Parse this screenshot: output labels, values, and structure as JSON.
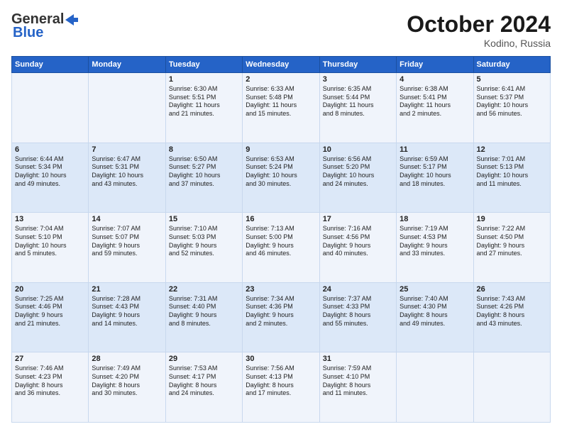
{
  "header": {
    "logo_general": "General",
    "logo_blue": "Blue",
    "month_title": "October 2024",
    "location": "Kodino, Russia"
  },
  "weekdays": [
    "Sunday",
    "Monday",
    "Tuesday",
    "Wednesday",
    "Thursday",
    "Friday",
    "Saturday"
  ],
  "weeks": [
    [
      {
        "day": "",
        "lines": []
      },
      {
        "day": "",
        "lines": []
      },
      {
        "day": "1",
        "lines": [
          "Sunrise: 6:30 AM",
          "Sunset: 5:51 PM",
          "Daylight: 11 hours",
          "and 21 minutes."
        ]
      },
      {
        "day": "2",
        "lines": [
          "Sunrise: 6:33 AM",
          "Sunset: 5:48 PM",
          "Daylight: 11 hours",
          "and 15 minutes."
        ]
      },
      {
        "day": "3",
        "lines": [
          "Sunrise: 6:35 AM",
          "Sunset: 5:44 PM",
          "Daylight: 11 hours",
          "and 8 minutes."
        ]
      },
      {
        "day": "4",
        "lines": [
          "Sunrise: 6:38 AM",
          "Sunset: 5:41 PM",
          "Daylight: 11 hours",
          "and 2 minutes."
        ]
      },
      {
        "day": "5",
        "lines": [
          "Sunrise: 6:41 AM",
          "Sunset: 5:37 PM",
          "Daylight: 10 hours",
          "and 56 minutes."
        ]
      }
    ],
    [
      {
        "day": "6",
        "lines": [
          "Sunrise: 6:44 AM",
          "Sunset: 5:34 PM",
          "Daylight: 10 hours",
          "and 49 minutes."
        ]
      },
      {
        "day": "7",
        "lines": [
          "Sunrise: 6:47 AM",
          "Sunset: 5:31 PM",
          "Daylight: 10 hours",
          "and 43 minutes."
        ]
      },
      {
        "day": "8",
        "lines": [
          "Sunrise: 6:50 AM",
          "Sunset: 5:27 PM",
          "Daylight: 10 hours",
          "and 37 minutes."
        ]
      },
      {
        "day": "9",
        "lines": [
          "Sunrise: 6:53 AM",
          "Sunset: 5:24 PM",
          "Daylight: 10 hours",
          "and 30 minutes."
        ]
      },
      {
        "day": "10",
        "lines": [
          "Sunrise: 6:56 AM",
          "Sunset: 5:20 PM",
          "Daylight: 10 hours",
          "and 24 minutes."
        ]
      },
      {
        "day": "11",
        "lines": [
          "Sunrise: 6:59 AM",
          "Sunset: 5:17 PM",
          "Daylight: 10 hours",
          "and 18 minutes."
        ]
      },
      {
        "day": "12",
        "lines": [
          "Sunrise: 7:01 AM",
          "Sunset: 5:13 PM",
          "Daylight: 10 hours",
          "and 11 minutes."
        ]
      }
    ],
    [
      {
        "day": "13",
        "lines": [
          "Sunrise: 7:04 AM",
          "Sunset: 5:10 PM",
          "Daylight: 10 hours",
          "and 5 minutes."
        ]
      },
      {
        "day": "14",
        "lines": [
          "Sunrise: 7:07 AM",
          "Sunset: 5:07 PM",
          "Daylight: 9 hours",
          "and 59 minutes."
        ]
      },
      {
        "day": "15",
        "lines": [
          "Sunrise: 7:10 AM",
          "Sunset: 5:03 PM",
          "Daylight: 9 hours",
          "and 52 minutes."
        ]
      },
      {
        "day": "16",
        "lines": [
          "Sunrise: 7:13 AM",
          "Sunset: 5:00 PM",
          "Daylight: 9 hours",
          "and 46 minutes."
        ]
      },
      {
        "day": "17",
        "lines": [
          "Sunrise: 7:16 AM",
          "Sunset: 4:56 PM",
          "Daylight: 9 hours",
          "and 40 minutes."
        ]
      },
      {
        "day": "18",
        "lines": [
          "Sunrise: 7:19 AM",
          "Sunset: 4:53 PM",
          "Daylight: 9 hours",
          "and 33 minutes."
        ]
      },
      {
        "day": "19",
        "lines": [
          "Sunrise: 7:22 AM",
          "Sunset: 4:50 PM",
          "Daylight: 9 hours",
          "and 27 minutes."
        ]
      }
    ],
    [
      {
        "day": "20",
        "lines": [
          "Sunrise: 7:25 AM",
          "Sunset: 4:46 PM",
          "Daylight: 9 hours",
          "and 21 minutes."
        ]
      },
      {
        "day": "21",
        "lines": [
          "Sunrise: 7:28 AM",
          "Sunset: 4:43 PM",
          "Daylight: 9 hours",
          "and 14 minutes."
        ]
      },
      {
        "day": "22",
        "lines": [
          "Sunrise: 7:31 AM",
          "Sunset: 4:40 PM",
          "Daylight: 9 hours",
          "and 8 minutes."
        ]
      },
      {
        "day": "23",
        "lines": [
          "Sunrise: 7:34 AM",
          "Sunset: 4:36 PM",
          "Daylight: 9 hours",
          "and 2 minutes."
        ]
      },
      {
        "day": "24",
        "lines": [
          "Sunrise: 7:37 AM",
          "Sunset: 4:33 PM",
          "Daylight: 8 hours",
          "and 55 minutes."
        ]
      },
      {
        "day": "25",
        "lines": [
          "Sunrise: 7:40 AM",
          "Sunset: 4:30 PM",
          "Daylight: 8 hours",
          "and 49 minutes."
        ]
      },
      {
        "day": "26",
        "lines": [
          "Sunrise: 7:43 AM",
          "Sunset: 4:26 PM",
          "Daylight: 8 hours",
          "and 43 minutes."
        ]
      }
    ],
    [
      {
        "day": "27",
        "lines": [
          "Sunrise: 7:46 AM",
          "Sunset: 4:23 PM",
          "Daylight: 8 hours",
          "and 36 minutes."
        ]
      },
      {
        "day": "28",
        "lines": [
          "Sunrise: 7:49 AM",
          "Sunset: 4:20 PM",
          "Daylight: 8 hours",
          "and 30 minutes."
        ]
      },
      {
        "day": "29",
        "lines": [
          "Sunrise: 7:53 AM",
          "Sunset: 4:17 PM",
          "Daylight: 8 hours",
          "and 24 minutes."
        ]
      },
      {
        "day": "30",
        "lines": [
          "Sunrise: 7:56 AM",
          "Sunset: 4:13 PM",
          "Daylight: 8 hours",
          "and 17 minutes."
        ]
      },
      {
        "day": "31",
        "lines": [
          "Sunrise: 7:59 AM",
          "Sunset: 4:10 PM",
          "Daylight: 8 hours",
          "and 11 minutes."
        ]
      },
      {
        "day": "",
        "lines": []
      },
      {
        "day": "",
        "lines": []
      }
    ]
  ]
}
